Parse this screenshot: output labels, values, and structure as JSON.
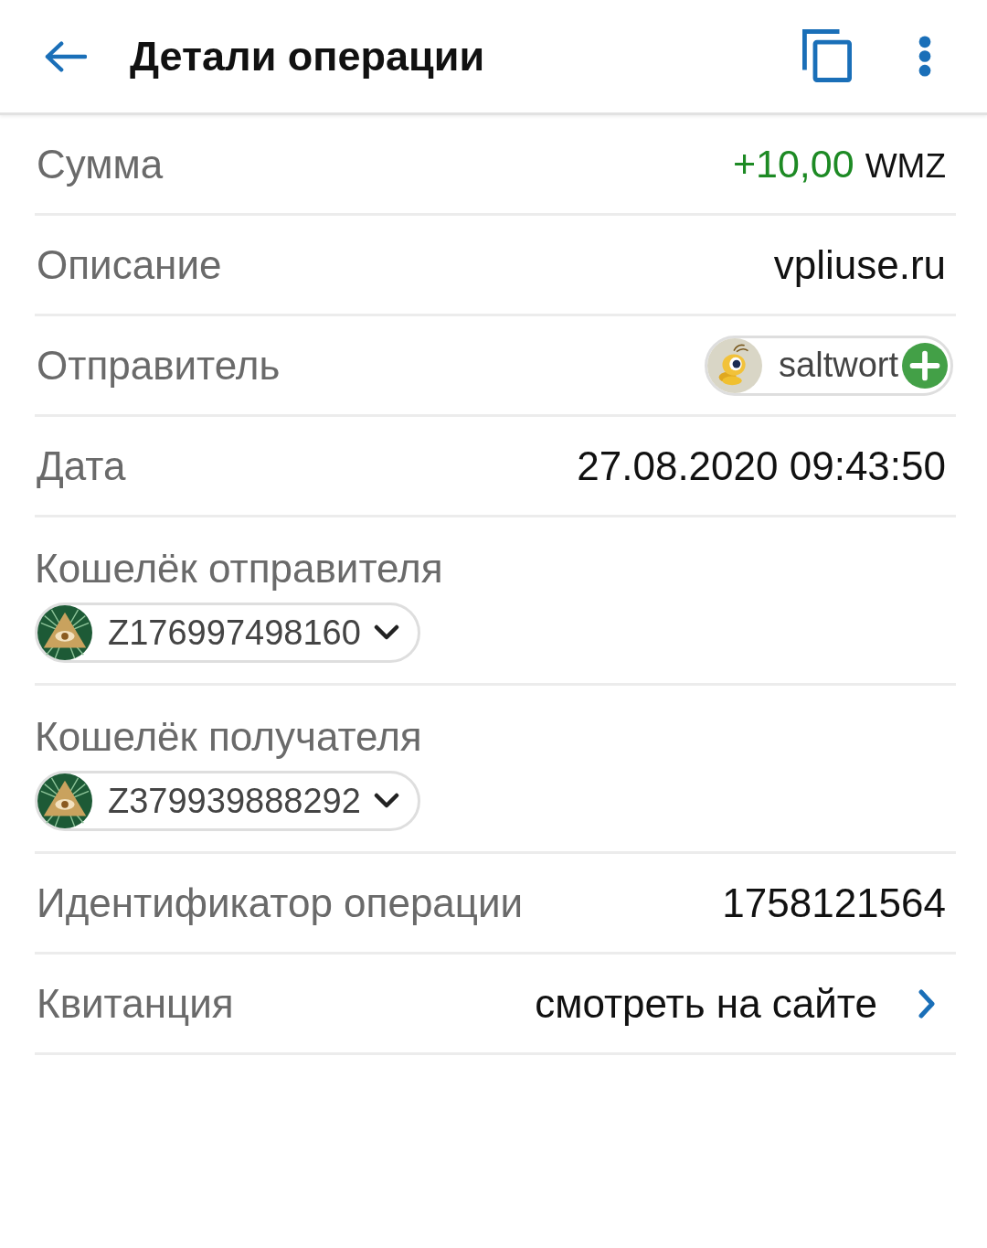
{
  "header": {
    "title": "Детали операции"
  },
  "rows": [
    {
      "kind": "amount",
      "label": "Сумма",
      "amount": "+10,00",
      "currency": "WMZ"
    },
    {
      "kind": "text",
      "label": "Описание",
      "value": "vpliuse.ru"
    },
    {
      "kind": "contact",
      "label": "Отправитель",
      "value": "saltwort"
    },
    {
      "kind": "text",
      "label": "Дата",
      "value": "27.08.2020 09:43:50"
    },
    {
      "kind": "wallet",
      "label": "Кошелёк отправителя",
      "value": "Z176997498160"
    },
    {
      "kind": "wallet",
      "label": "Кошелёк получателя",
      "value": "Z379939888292"
    },
    {
      "kind": "text",
      "label": "Идентификатор операции",
      "value": "1758121564"
    },
    {
      "kind": "link",
      "label": "Квитанция",
      "value": "смотреть на сайте"
    }
  ]
}
